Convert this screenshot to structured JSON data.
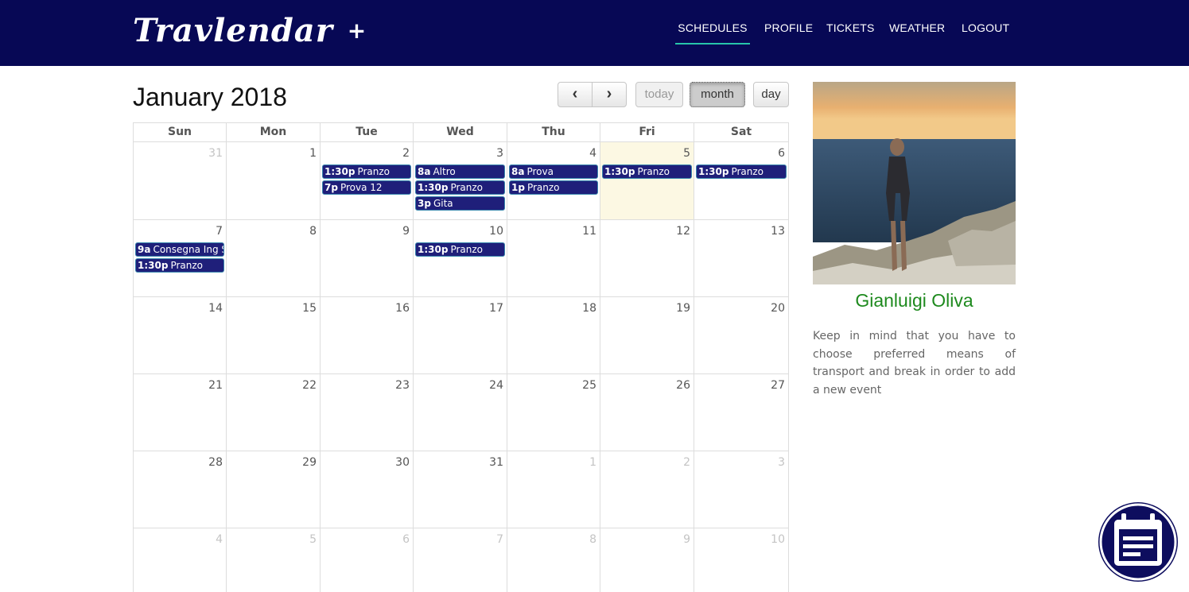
{
  "navbar": {
    "brand": "Travlendar",
    "brand_plus": "+",
    "links": [
      "SCHEDULES",
      "PROFILE",
      "TICKETS",
      "WEATHER",
      "LOGOUT"
    ],
    "active": "SCHEDULES",
    "colors": {
      "background": "#070855",
      "active_underline": "#27c4a9"
    }
  },
  "calendar": {
    "title": "January 2018",
    "buttons": {
      "prev": "‹",
      "next": "›",
      "today": "today",
      "month": "month",
      "day": "day"
    },
    "weekdays": [
      "Sun",
      "Mon",
      "Tue",
      "Wed",
      "Thu",
      "Fri",
      "Sat"
    ],
    "weeks": [
      [
        {
          "day": "31",
          "other": true,
          "events": []
        },
        {
          "day": "1",
          "events": []
        },
        {
          "day": "2",
          "events": [
            {
              "time": "1:30p",
              "title": "Pranzo"
            },
            {
              "time": "7p",
              "title": "Prova 12"
            }
          ]
        },
        {
          "day": "3",
          "events": [
            {
              "time": "8a",
              "title": "Altro"
            },
            {
              "time": "1:30p",
              "title": "Pranzo"
            },
            {
              "time": "3p",
              "title": "Gita"
            }
          ]
        },
        {
          "day": "4",
          "events": [
            {
              "time": "8a",
              "title": "Prova"
            },
            {
              "time": "1p",
              "title": "Pranzo"
            }
          ]
        },
        {
          "day": "5",
          "today": true,
          "events": [
            {
              "time": "1:30p",
              "title": "Pranzo"
            }
          ]
        },
        {
          "day": "6",
          "events": [
            {
              "time": "1:30p",
              "title": "Pranzo"
            }
          ]
        }
      ],
      [
        {
          "day": "7",
          "events": [
            {
              "time": "9a",
              "title": "Consegna Ing S"
            },
            {
              "time": "1:30p",
              "title": "Pranzo"
            }
          ]
        },
        {
          "day": "8",
          "events": []
        },
        {
          "day": "9",
          "events": []
        },
        {
          "day": "10",
          "events": [
            {
              "time": "1:30p",
              "title": "Pranzo"
            }
          ]
        },
        {
          "day": "11",
          "events": []
        },
        {
          "day": "12",
          "events": []
        },
        {
          "day": "13",
          "events": []
        }
      ],
      [
        {
          "day": "14",
          "events": []
        },
        {
          "day": "15",
          "events": []
        },
        {
          "day": "16",
          "events": []
        },
        {
          "day": "17",
          "events": []
        },
        {
          "day": "18",
          "events": []
        },
        {
          "day": "19",
          "events": []
        },
        {
          "day": "20",
          "events": []
        }
      ],
      [
        {
          "day": "21",
          "events": []
        },
        {
          "day": "22",
          "events": []
        },
        {
          "day": "23",
          "events": []
        },
        {
          "day": "24",
          "events": []
        },
        {
          "day": "25",
          "events": []
        },
        {
          "day": "26",
          "events": []
        },
        {
          "day": "27",
          "events": []
        }
      ],
      [
        {
          "day": "28",
          "events": []
        },
        {
          "day": "29",
          "events": []
        },
        {
          "day": "30",
          "events": []
        },
        {
          "day": "31",
          "events": []
        },
        {
          "day": "1",
          "other": true,
          "events": []
        },
        {
          "day": "2",
          "other": true,
          "events": []
        },
        {
          "day": "3",
          "other": true,
          "events": []
        }
      ],
      [
        {
          "day": "4",
          "other": true,
          "events": []
        },
        {
          "day": "5",
          "other": true,
          "events": []
        },
        {
          "day": "6",
          "other": true,
          "events": []
        },
        {
          "day": "7",
          "other": true,
          "events": []
        },
        {
          "day": "8",
          "other": true,
          "events": []
        },
        {
          "day": "9",
          "other": true,
          "events": []
        },
        {
          "day": "10",
          "other": true,
          "events": []
        }
      ]
    ],
    "colors": {
      "event_bg": "#1f1f7a",
      "event_border": "#3a87ad",
      "today_bg": "#fcf8e3"
    }
  },
  "profile": {
    "name": "Gianluigi Oliva",
    "note": "Keep in mind that you have to choose preferred means of transport and break in order to add a new event",
    "photo_icon": "profile-photo"
  },
  "fab": {
    "icon": "calendar-icon"
  }
}
